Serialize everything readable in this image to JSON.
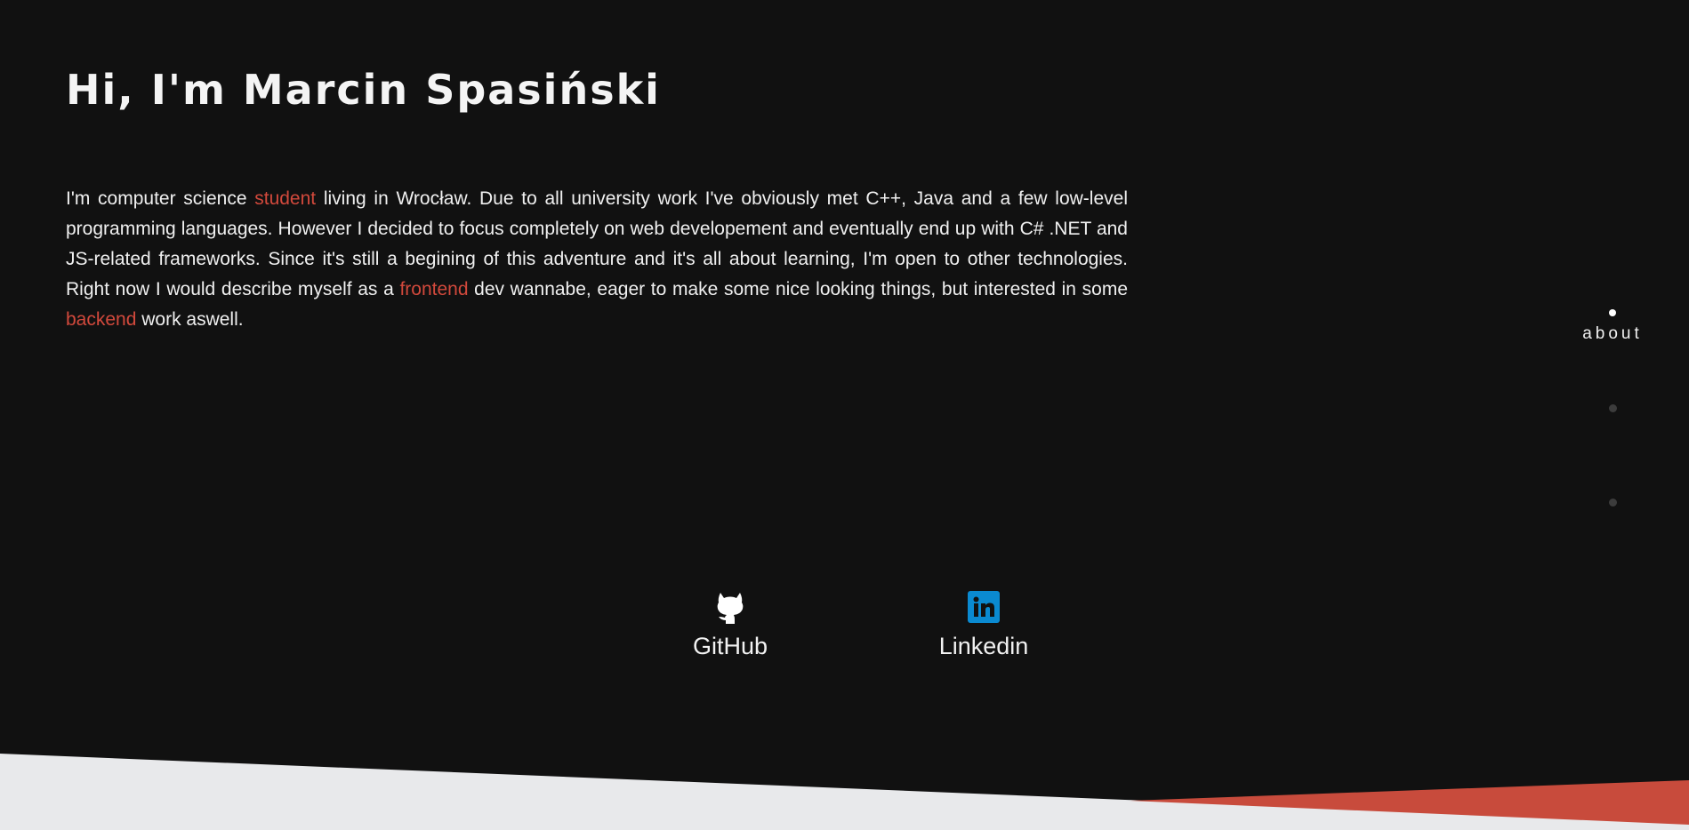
{
  "header": {
    "title": "Hi, I'm Marcin Spasiński"
  },
  "bio": {
    "part1": "I'm computer science ",
    "highlight1": "student",
    "part2": " living in Wrocław. Due to all university work I've obviously met C++, Java and a few low-level programming languages. However I decided to focus completely on web developement and eventually end up with C# .NET and JS-related frameworks. Since it's still a begining of this adventure and it's all about learning, I'm open to other technologies. Right now I would describe myself as a ",
    "highlight2": "frontend",
    "part3": " dev wannabe, eager to make some nice looking things, but interested in some ",
    "highlight3": "backend",
    "part4": " work aswell."
  },
  "side_nav": {
    "items": [
      {
        "label": "about",
        "active": true
      },
      {
        "label": "",
        "active": false
      },
      {
        "label": "",
        "active": false
      }
    ]
  },
  "social": {
    "github": {
      "label": "GitHub",
      "icon": "github-icon"
    },
    "linkedin": {
      "label": "Linkedin",
      "icon": "linkedin-icon"
    }
  },
  "colors": {
    "background": "#111111",
    "accent": "#d2493c",
    "footer_light": "#e8e9eb",
    "linkedin_blue": "#0a8ad1"
  }
}
